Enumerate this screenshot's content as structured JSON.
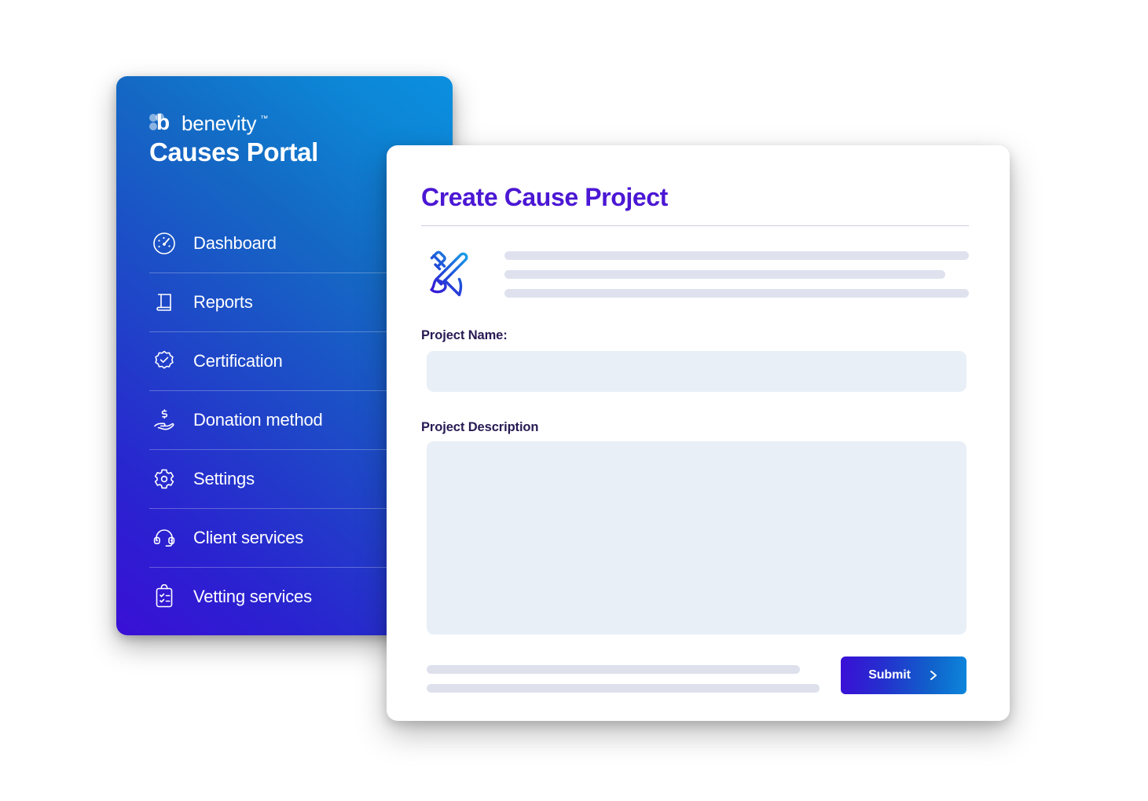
{
  "sidebar": {
    "logo": {
      "mark_icon": "benevity-flower-b-icon",
      "wordmark": "benevity",
      "trademark": "™"
    },
    "title": "Causes Portal",
    "items": [
      {
        "label": "Dashboard",
        "icon": "gauge-icon"
      },
      {
        "label": "Reports",
        "icon": "book-icon"
      },
      {
        "label": "Certification",
        "icon": "badge-check-icon"
      },
      {
        "label": "Donation method",
        "icon": "hand-dollar-icon"
      },
      {
        "label": "Settings",
        "icon": "gear-icon"
      },
      {
        "label": "Client services",
        "icon": "headset-icon"
      },
      {
        "label": "Vetting services",
        "icon": "clipboard-checklist-icon"
      }
    ]
  },
  "card": {
    "title": "Create Cause Project",
    "intro": {
      "icon": "paintbrush-pencil-icon",
      "placeholder_lines": [
        "full",
        "short",
        "full"
      ]
    },
    "form": {
      "name_label": "Project Name:",
      "name_value": "",
      "name_placeholder": "",
      "description_label": "Project Description",
      "description_value": "",
      "description_placeholder": ""
    },
    "footer": {
      "placeholder_lines": [
        "short",
        "full"
      ],
      "submit_label": "Submit",
      "submit_icon": "chevron-right-icon"
    }
  },
  "colors": {
    "title_violet": "#4B17D4",
    "label_ink": "#281B54",
    "field_fill": "#E9EFF7",
    "placeholder_gray": "#DFE2EE",
    "sidebar_gradient_from": "#3A0FD6",
    "sidebar_gradient_to": "#0C8FE0",
    "card_white": "#FFFFFF"
  }
}
